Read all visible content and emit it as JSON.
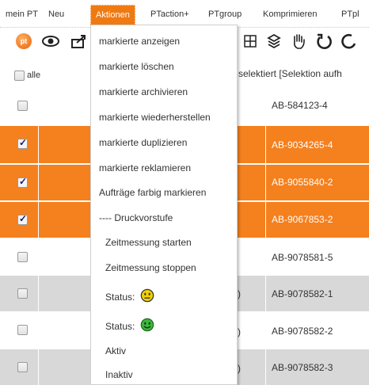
{
  "menubar": {
    "items": [
      {
        "label": "mein PT",
        "active": false
      },
      {
        "label": "Neu",
        "active": false
      },
      {
        "label": "Aktionen",
        "active": true
      },
      {
        "label": "PTaction+",
        "active": false
      },
      {
        "label": "PTgroup",
        "active": false
      },
      {
        "label": "Komprimieren",
        "active": false
      },
      {
        "label": "PTpl",
        "active": false
      }
    ]
  },
  "toolbar": {
    "pt_label": "pt",
    "icons": [
      "pt-logo-icon",
      "eye-icon",
      "export-icon",
      "grid-icon",
      "stack-icon",
      "hand-icon",
      "undo-icon",
      "redo-icon"
    ]
  },
  "table": {
    "header": {
      "select_all_label": "alle",
      "selection_info": "selektiert [Selektion aufh"
    },
    "rows": [
      {
        "checked": false,
        "style": "white",
        "id": "AB-584123-4",
        "paren": ""
      },
      {
        "checked": true,
        "style": "sel",
        "id": "AB-9034265-4",
        "paren": ""
      },
      {
        "checked": true,
        "style": "sel",
        "id": "AB-9055840-2",
        "paren": ""
      },
      {
        "checked": true,
        "style": "sel",
        "id": "AB-9067853-2",
        "paren": ""
      },
      {
        "checked": false,
        "style": "white",
        "id": "AB-9078581-5",
        "paren": ""
      },
      {
        "checked": false,
        "style": "grey",
        "id": "AB-9078582-1",
        "paren": ")"
      },
      {
        "checked": false,
        "style": "white",
        "id": "AB-9078582-2",
        "paren": ")"
      },
      {
        "checked": false,
        "style": "grey",
        "id": "AB-9078582-3",
        "paren": ")"
      }
    ]
  },
  "dropdown": {
    "items": [
      {
        "label": "markierte anzeigen"
      },
      {
        "label": "markierte löschen"
      },
      {
        "label": "markierte archivieren"
      },
      {
        "label": "markierte wiederherstellen"
      },
      {
        "label": "markierte duplizieren"
      },
      {
        "label": "markierte reklamieren"
      },
      {
        "label": "Aufträge farbig markieren"
      },
      {
        "label": "---- Druckvorstufe"
      },
      {
        "label": "Zeitmessung starten"
      },
      {
        "label": "Zeitmessung stoppen"
      },
      {
        "label": "Status:",
        "icon": "neutral-face-icon"
      },
      {
        "label": "Status:",
        "icon": "smile-face-icon"
      },
      {
        "label": "Aktiv"
      },
      {
        "label": "Inaktiv"
      }
    ]
  },
  "colors": {
    "accent": "#f07a12",
    "selected_row": "#f5801e",
    "grey_row": "#d8d8d8",
    "neutral_face": "#f2d000",
    "smile_face": "#3cb83c"
  }
}
